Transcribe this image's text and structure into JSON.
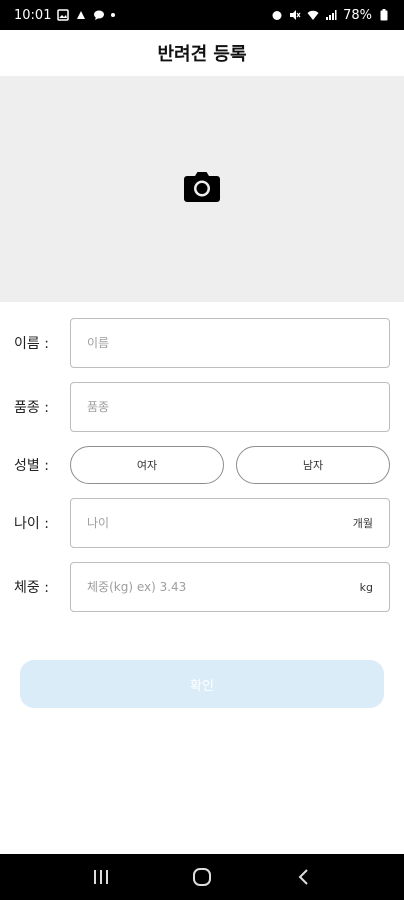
{
  "status_bar": {
    "time": "10:01",
    "battery": "78%"
  },
  "header": {
    "title": "반려견 등록"
  },
  "photo": {
    "icon": "camera-icon"
  },
  "form": {
    "name": {
      "label": "이름 :",
      "placeholder": "이름"
    },
    "breed": {
      "label": "품종 :",
      "placeholder": "품종"
    },
    "gender": {
      "label": "성별 :",
      "female": "여자",
      "male": "남자"
    },
    "age": {
      "label": "나이 :",
      "placeholder": "나이",
      "unit": "개월"
    },
    "weight": {
      "label": "체중 :",
      "placeholder": "체중(kg) ex) 3.43",
      "unit": "kg"
    }
  },
  "submit": {
    "label": "확인"
  },
  "nav": {
    "recent_icon": "recent-apps-icon",
    "home_icon": "home-icon",
    "back_icon": "back-icon"
  }
}
